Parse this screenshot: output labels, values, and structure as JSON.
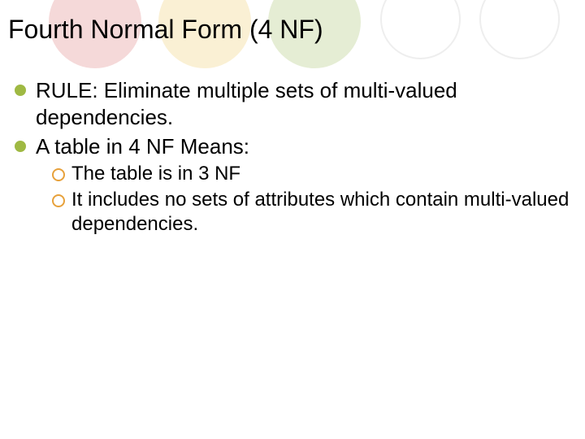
{
  "title": "Fourth Normal Form (4 NF)",
  "colors": {
    "bullet1": "#9fb943",
    "bullet2": "#9fb943",
    "sub1": "#e7a13b",
    "sub2": "#e7a13b",
    "circleRed": "#f5d9d9",
    "circleYellow": "#faf0d4",
    "circleGreen": "#e5edd4",
    "circleGray": "#eeeeee"
  },
  "bullets": [
    {
      "text": "RULE: Eliminate multiple sets of multi-valued dependencies."
    },
    {
      "text": "A table in 4 NF Means:",
      "sub": [
        {
          "text": "The table is in 3 NF"
        },
        {
          "text": "It includes no sets of attributes which contain multi-valued dependencies."
        }
      ]
    }
  ]
}
